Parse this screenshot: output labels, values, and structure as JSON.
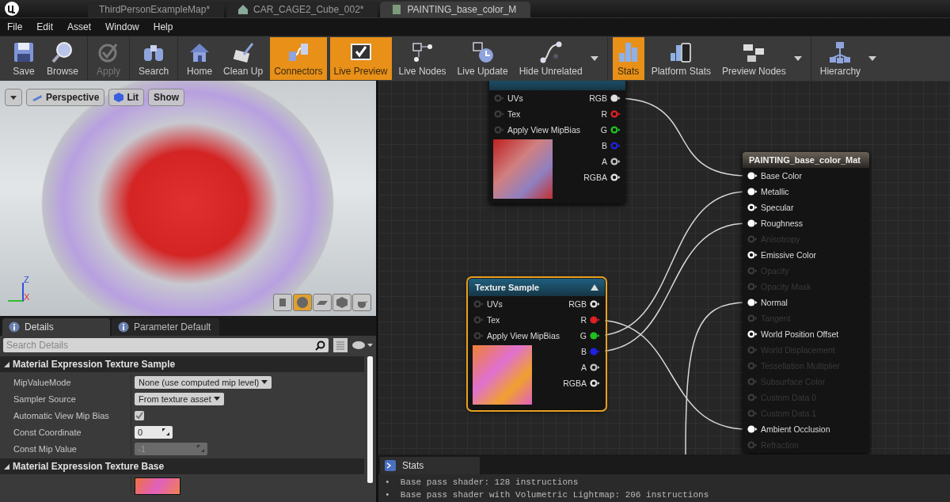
{
  "tabs": [
    {
      "label": "ThirdPersonExampleMap*",
      "selected": false
    },
    {
      "label": "CAR_CAGE2_Cube_002*",
      "selected": false
    },
    {
      "label": "PAINTING_base_color_M",
      "selected": true
    }
  ],
  "menu": [
    "File",
    "Edit",
    "Asset",
    "Window",
    "Help"
  ],
  "toolbar_groups": [
    [
      {
        "label": "Save",
        "selected": false,
        "disabled": false,
        "dropdown": false
      },
      {
        "label": "Browse",
        "selected": false,
        "disabled": false,
        "dropdown": false
      }
    ],
    [
      {
        "label": "Apply",
        "selected": false,
        "disabled": true,
        "dropdown": false
      }
    ],
    [
      {
        "label": "Search",
        "selected": false,
        "disabled": false,
        "dropdown": false
      }
    ],
    [
      {
        "label": "Home",
        "selected": false,
        "disabled": false,
        "dropdown": false
      },
      {
        "label": "Clean Up",
        "selected": false,
        "disabled": false,
        "dropdown": false
      },
      {
        "label": "Connectors",
        "selected": true,
        "disabled": false,
        "dropdown": false
      },
      {
        "label": "Live Preview",
        "selected": true,
        "disabled": false,
        "dropdown": false
      },
      {
        "label": "Live Nodes",
        "selected": false,
        "disabled": false,
        "dropdown": false
      },
      {
        "label": "Live Update",
        "selected": false,
        "disabled": false,
        "dropdown": false
      },
      {
        "label": "Hide Unrelated",
        "selected": false,
        "disabled": false,
        "dropdown": true
      }
    ],
    [
      {
        "label": "Stats",
        "selected": true,
        "disabled": false,
        "dropdown": false
      },
      {
        "label": "Platform Stats",
        "selected": false,
        "disabled": false,
        "dropdown": false
      },
      {
        "label": "Preview Nodes",
        "selected": false,
        "disabled": false,
        "dropdown": true
      }
    ],
    [
      {
        "label": "Hierarchy",
        "selected": false,
        "disabled": false,
        "dropdown": true
      }
    ]
  ],
  "viewport": {
    "buttons": [
      "Perspective",
      "Lit",
      "Show"
    ],
    "axis_labels": [
      "Z",
      "X"
    ],
    "view_modes": [
      {
        "selected": false
      },
      {
        "selected": true
      },
      {
        "selected": false
      },
      {
        "selected": false
      },
      {
        "selected": false
      }
    ]
  },
  "details": {
    "tabs": [
      {
        "label": "Details",
        "selected": true
      },
      {
        "label": "Parameter Default",
        "selected": false
      }
    ],
    "search": {
      "placeholder": "Search Details"
    },
    "sections": [
      {
        "title": "Material Expression Texture Sample",
        "expanded": true,
        "rows": [
          {
            "label": "MipValueMode",
            "kind": "dropdown",
            "value": "None (use computed mip level)"
          },
          {
            "label": "Sampler Source",
            "kind": "dropdown",
            "value": "From texture asset"
          },
          {
            "label": "Automatic View Mip Bias",
            "kind": "checkbox",
            "checked": true
          },
          {
            "label": "Const Coordinate",
            "kind": "number",
            "value": "0",
            "disabled": false
          },
          {
            "label": "Const Mip Value",
            "kind": "number",
            "value": "-1",
            "disabled": true
          }
        ]
      },
      {
        "title": "Material Expression Texture Base",
        "expanded": true,
        "rows": [
          {
            "kind": "texture"
          }
        ]
      }
    ]
  },
  "graph": {
    "texture_nodes": [
      {
        "selected": false,
        "inputs": [
          "UVs",
          "Tex",
          "Apply View MipBias"
        ],
        "outputs": [
          {
            "label": "RGB",
            "color": "#e0e0e0",
            "connected": true
          },
          {
            "label": "R",
            "color": "#e02020",
            "connected": false
          },
          {
            "label": "G",
            "color": "#20c020",
            "connected": false
          },
          {
            "label": "B",
            "color": "#2020e0",
            "connected": false
          },
          {
            "label": "A",
            "color": "#c0c0c0",
            "connected": false
          },
          {
            "label": "RGBA",
            "color": "#e0e0e0",
            "connected": false
          }
        ]
      },
      {
        "title": "Texture Sample",
        "selected": true,
        "inputs": [
          "UVs",
          "Tex",
          "Apply View MipBias"
        ],
        "outputs": [
          {
            "label": "RGB",
            "color": "#e0e0e0",
            "connected": false
          },
          {
            "label": "R",
            "color": "#e02020",
            "connected": true
          },
          {
            "label": "G",
            "color": "#20c020",
            "connected": true
          },
          {
            "label": "B",
            "color": "#2020e0",
            "connected": true
          },
          {
            "label": "A",
            "color": "#c0c0c0",
            "connected": false
          },
          {
            "label": "RGBA",
            "color": "#e0e0e0",
            "connected": false
          }
        ]
      }
    ],
    "material_node": {
      "title": "PAINTING_base_color_Mat",
      "pins": [
        {
          "label": "Base Color",
          "connected": true,
          "disabled": false
        },
        {
          "label": "Metallic",
          "connected": true,
          "disabled": false
        },
        {
          "label": "Specular",
          "connected": false,
          "disabled": false
        },
        {
          "label": "Roughness",
          "connected": true,
          "disabled": false
        },
        {
          "label": "Anisotropy",
          "connected": false,
          "disabled": true
        },
        {
          "label": "Emissive Color",
          "connected": false,
          "disabled": false
        },
        {
          "label": "Opacity",
          "connected": false,
          "disabled": true
        },
        {
          "label": "Opacity Mask",
          "connected": false,
          "disabled": true
        },
        {
          "label": "Normal",
          "connected": true,
          "disabled": false
        },
        {
          "label": "Tangent",
          "connected": false,
          "disabled": true
        },
        {
          "label": "World Position Offset",
          "connected": false,
          "disabled": false
        },
        {
          "label": "World Displacement",
          "connected": false,
          "disabled": true
        },
        {
          "label": "Tessellation Multiplier",
          "connected": false,
          "disabled": true
        },
        {
          "label": "Subsurface Color",
          "connected": false,
          "disabled": true
        },
        {
          "label": "Custom Data 0",
          "connected": false,
          "disabled": true
        },
        {
          "label": "Custom Data 1",
          "connected": false,
          "disabled": true
        },
        {
          "label": "Ambient Occlusion",
          "connected": true,
          "disabled": false
        },
        {
          "label": "Refraction",
          "connected": false,
          "disabled": true
        }
      ]
    }
  },
  "stats": {
    "tab": "Stats",
    "lines": [
      "•  Base pass shader: 128 instructions",
      "•  Base pass shader with Volumetric Lightmap: 206 instructions"
    ]
  }
}
